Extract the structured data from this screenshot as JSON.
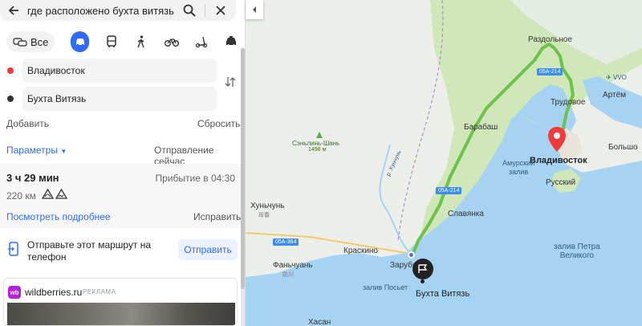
{
  "search": {
    "query": "где расположено бухта витязь"
  },
  "modes": {
    "all_label": "Все"
  },
  "route": {
    "from": "Владивосток",
    "to": "Бухта Витязь",
    "add_label": "Добавить",
    "reset_label": "Сбросить",
    "params_label": "Параметры",
    "departure_label": "Отправление сейчас"
  },
  "result": {
    "duration": "3 ч 29 мин",
    "arrival": "Прибытие в 04:30",
    "distance": "220 км",
    "details_label": "Посмотреть подробнее",
    "fix_label": "Исправить"
  },
  "send": {
    "text": "Отправьте этот маршрут на телефон",
    "button_label": "Отправить"
  },
  "ad": {
    "logo_text": "wb",
    "name": "wildberries.ru",
    "tag": "РЕКЛАМА"
  },
  "map": {
    "labels": {
      "razdolnoe": "Раздольное",
      "vvo": "VVO",
      "artem": "Артём",
      "trudovoe": "Трудовое",
      "barabash": "Барабаш",
      "bolsho": "Большо",
      "vladivostok": "Владивосток",
      "russkiy": "Русский",
      "amur_bay": "Амурский\nзалив",
      "peter_bay": "залив Петра\nВеликого",
      "mountain": "Сэньлинь-Шань",
      "mountain_height": "1498 м",
      "river": "р. Хунчунь",
      "hunchun": "Хуньчунь",
      "hunchun_cn": "珲春",
      "slavyanka": "Славянка",
      "kraskino": "Краскино",
      "fanchuan": "Фаньчуань",
      "fanchuan_cn": "防川",
      "zarubino": "Зарубино",
      "posiet_bay": "залив Посьет",
      "vityaz": "Бухта Витязь",
      "hasan": "Хасан",
      "road_05a214": "05A-214",
      "road_05a214b": "05A-214",
      "road_05a364": "05A-364"
    }
  },
  "colors": {
    "accent": "#2f6bff",
    "route": "#6cc24a",
    "pin": "#f33a3a",
    "water": "#a7d3f2",
    "forest": "#c8e6b0"
  }
}
